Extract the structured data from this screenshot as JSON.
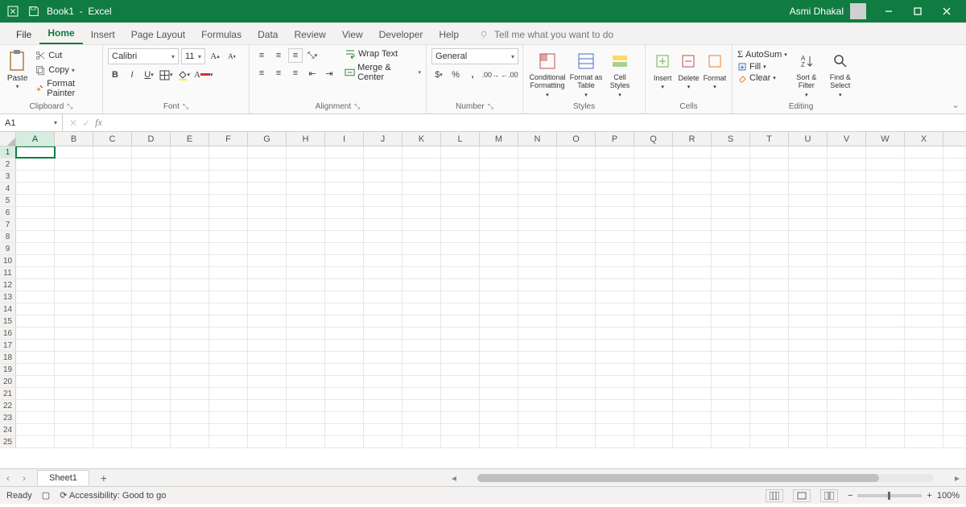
{
  "title": {
    "doc": "Book1",
    "app": "Excel",
    "user": "Asmi Dhakal"
  },
  "tabs": [
    "File",
    "Home",
    "Insert",
    "Page Layout",
    "Formulas",
    "Data",
    "Review",
    "View",
    "Developer",
    "Help"
  ],
  "active_tab": "Home",
  "tellme": "Tell me what you want to do",
  "ribbon": {
    "clipboard": {
      "paste": "Paste",
      "cut": "Cut",
      "copy": "Copy",
      "painter": "Format Painter",
      "label": "Clipboard"
    },
    "font": {
      "name": "Calibri",
      "size": "11",
      "label": "Font"
    },
    "alignment": {
      "wrap": "Wrap Text",
      "merge": "Merge & Center",
      "label": "Alignment"
    },
    "number": {
      "format": "General",
      "label": "Number"
    },
    "styles": {
      "cond": "Conditional Formatting",
      "table": "Format as Table",
      "cell": "Cell Styles",
      "label": "Styles"
    },
    "cells": {
      "insert": "Insert",
      "delete": "Delete",
      "format": "Format",
      "label": "Cells"
    },
    "editing": {
      "autosum": "AutoSum",
      "fill": "Fill",
      "clear": "Clear",
      "sort": "Sort & Filter",
      "find": "Find & Select",
      "label": "Editing"
    }
  },
  "namebox": "A1",
  "columns": [
    "A",
    "B",
    "C",
    "D",
    "E",
    "F",
    "G",
    "H",
    "I",
    "J",
    "K",
    "L",
    "M",
    "N",
    "O",
    "P",
    "Q",
    "R",
    "S",
    "T",
    "U",
    "V",
    "W",
    "X"
  ],
  "rows": 25,
  "active_cell": {
    "row": 1,
    "col": 0
  },
  "sheet": "Sheet1",
  "status": {
    "ready": "Ready",
    "acc": "Accessibility: Good to go",
    "zoom": "100%"
  }
}
